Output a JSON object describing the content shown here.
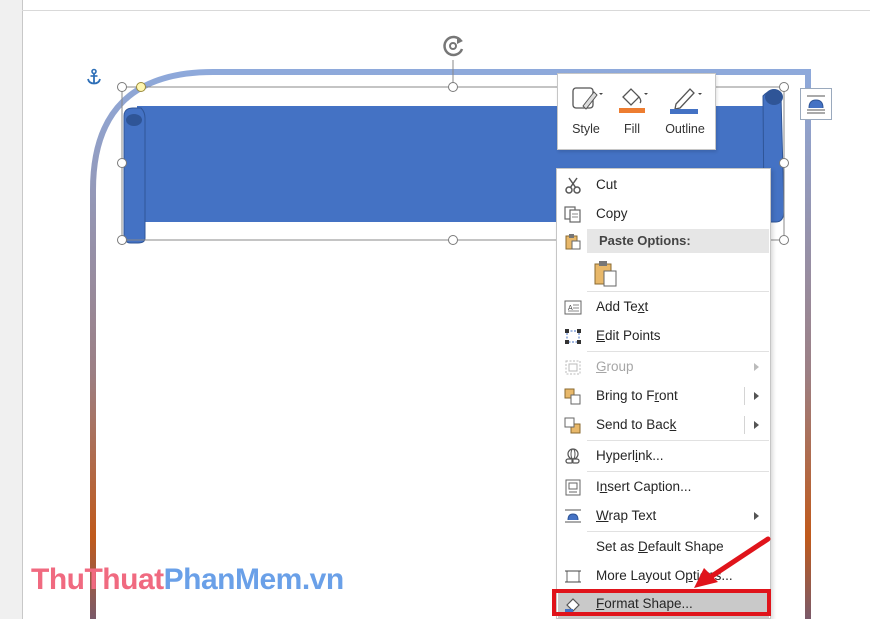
{
  "mini_toolbar": {
    "style_label": "Style",
    "fill_label": "Fill",
    "outline_label": "Outline"
  },
  "context_menu": {
    "cut": "Cut",
    "copy": "Copy",
    "paste_options_header": "Paste Options:",
    "add_text": "Add Text",
    "edit_points": "Edit Points",
    "group": "Group",
    "bring_to_front": "Bring to Front",
    "send_to_back": "Send to Back",
    "hyperlink": "Hyperlink...",
    "insert_caption": "Insert Caption...",
    "wrap_text": "Wrap Text",
    "set_default_shape": "Set as Default Shape",
    "more_layout_options": "More Layout Options...",
    "format_shape": "Format Shape..."
  },
  "watermark": {
    "part1": "ThuThuat",
    "part2": "PhanMem",
    "part3": ".vn"
  },
  "colors": {
    "banner_fill": "#4472c4",
    "frame_top": "#8ea9db",
    "frame_bottom": "#c55a11",
    "highlight_box": "#e0141b",
    "fill_swatch": "#ed7d31",
    "outline_swatch": "#4472c4"
  },
  "icons": {
    "anchor": "anchor-icon",
    "rotate": "rotate-handle-icon",
    "layout_options": "layout-options-icon"
  }
}
